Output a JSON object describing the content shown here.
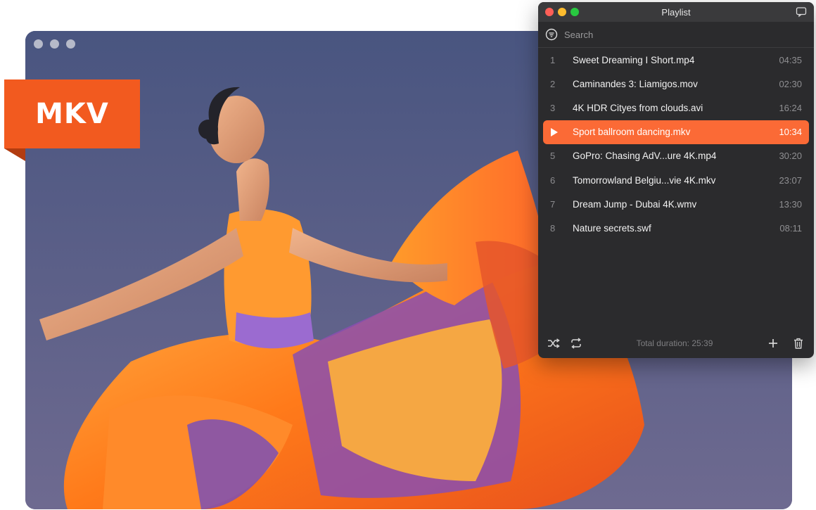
{
  "badge": {
    "label": "MKV"
  },
  "playlist": {
    "title": "Playlist",
    "search_placeholder": "Search",
    "items": [
      {
        "num": "1",
        "title": "Sweet Dreaming I Short.mp4",
        "duration": "04:35"
      },
      {
        "num": "2",
        "title": "Caminandes 3: Liamigos.mov",
        "duration": "02:30"
      },
      {
        "num": "3",
        "title": "4K HDR Cityes from clouds.avi",
        "duration": "16:24"
      },
      {
        "num": "4",
        "title": "Sport ballroom dancing.mkv",
        "duration": "10:34",
        "playing": true
      },
      {
        "num": "5",
        "title": "GoPro: Chasing AdV...ure 4K.mp4",
        "duration": "30:20"
      },
      {
        "num": "6",
        "title": "Tomorrowland Belgiu...vie 4K.mkv",
        "duration": "23:07"
      },
      {
        "num": "7",
        "title": "Dream Jump - Dubai 4K.wmv",
        "duration": "13:30"
      },
      {
        "num": "8",
        "title": "Nature secrets.swf",
        "duration": "08:11"
      }
    ],
    "total_duration": "Total duration: 25:39"
  },
  "colors": {
    "accent": "#fb6a36",
    "badge": "#f25a1f",
    "panel_bg": "#2b2b2d"
  },
  "icons": [
    "search-icon",
    "chat-icon",
    "play-icon",
    "shuffle-icon",
    "repeat-icon",
    "add-icon",
    "trash-icon"
  ]
}
